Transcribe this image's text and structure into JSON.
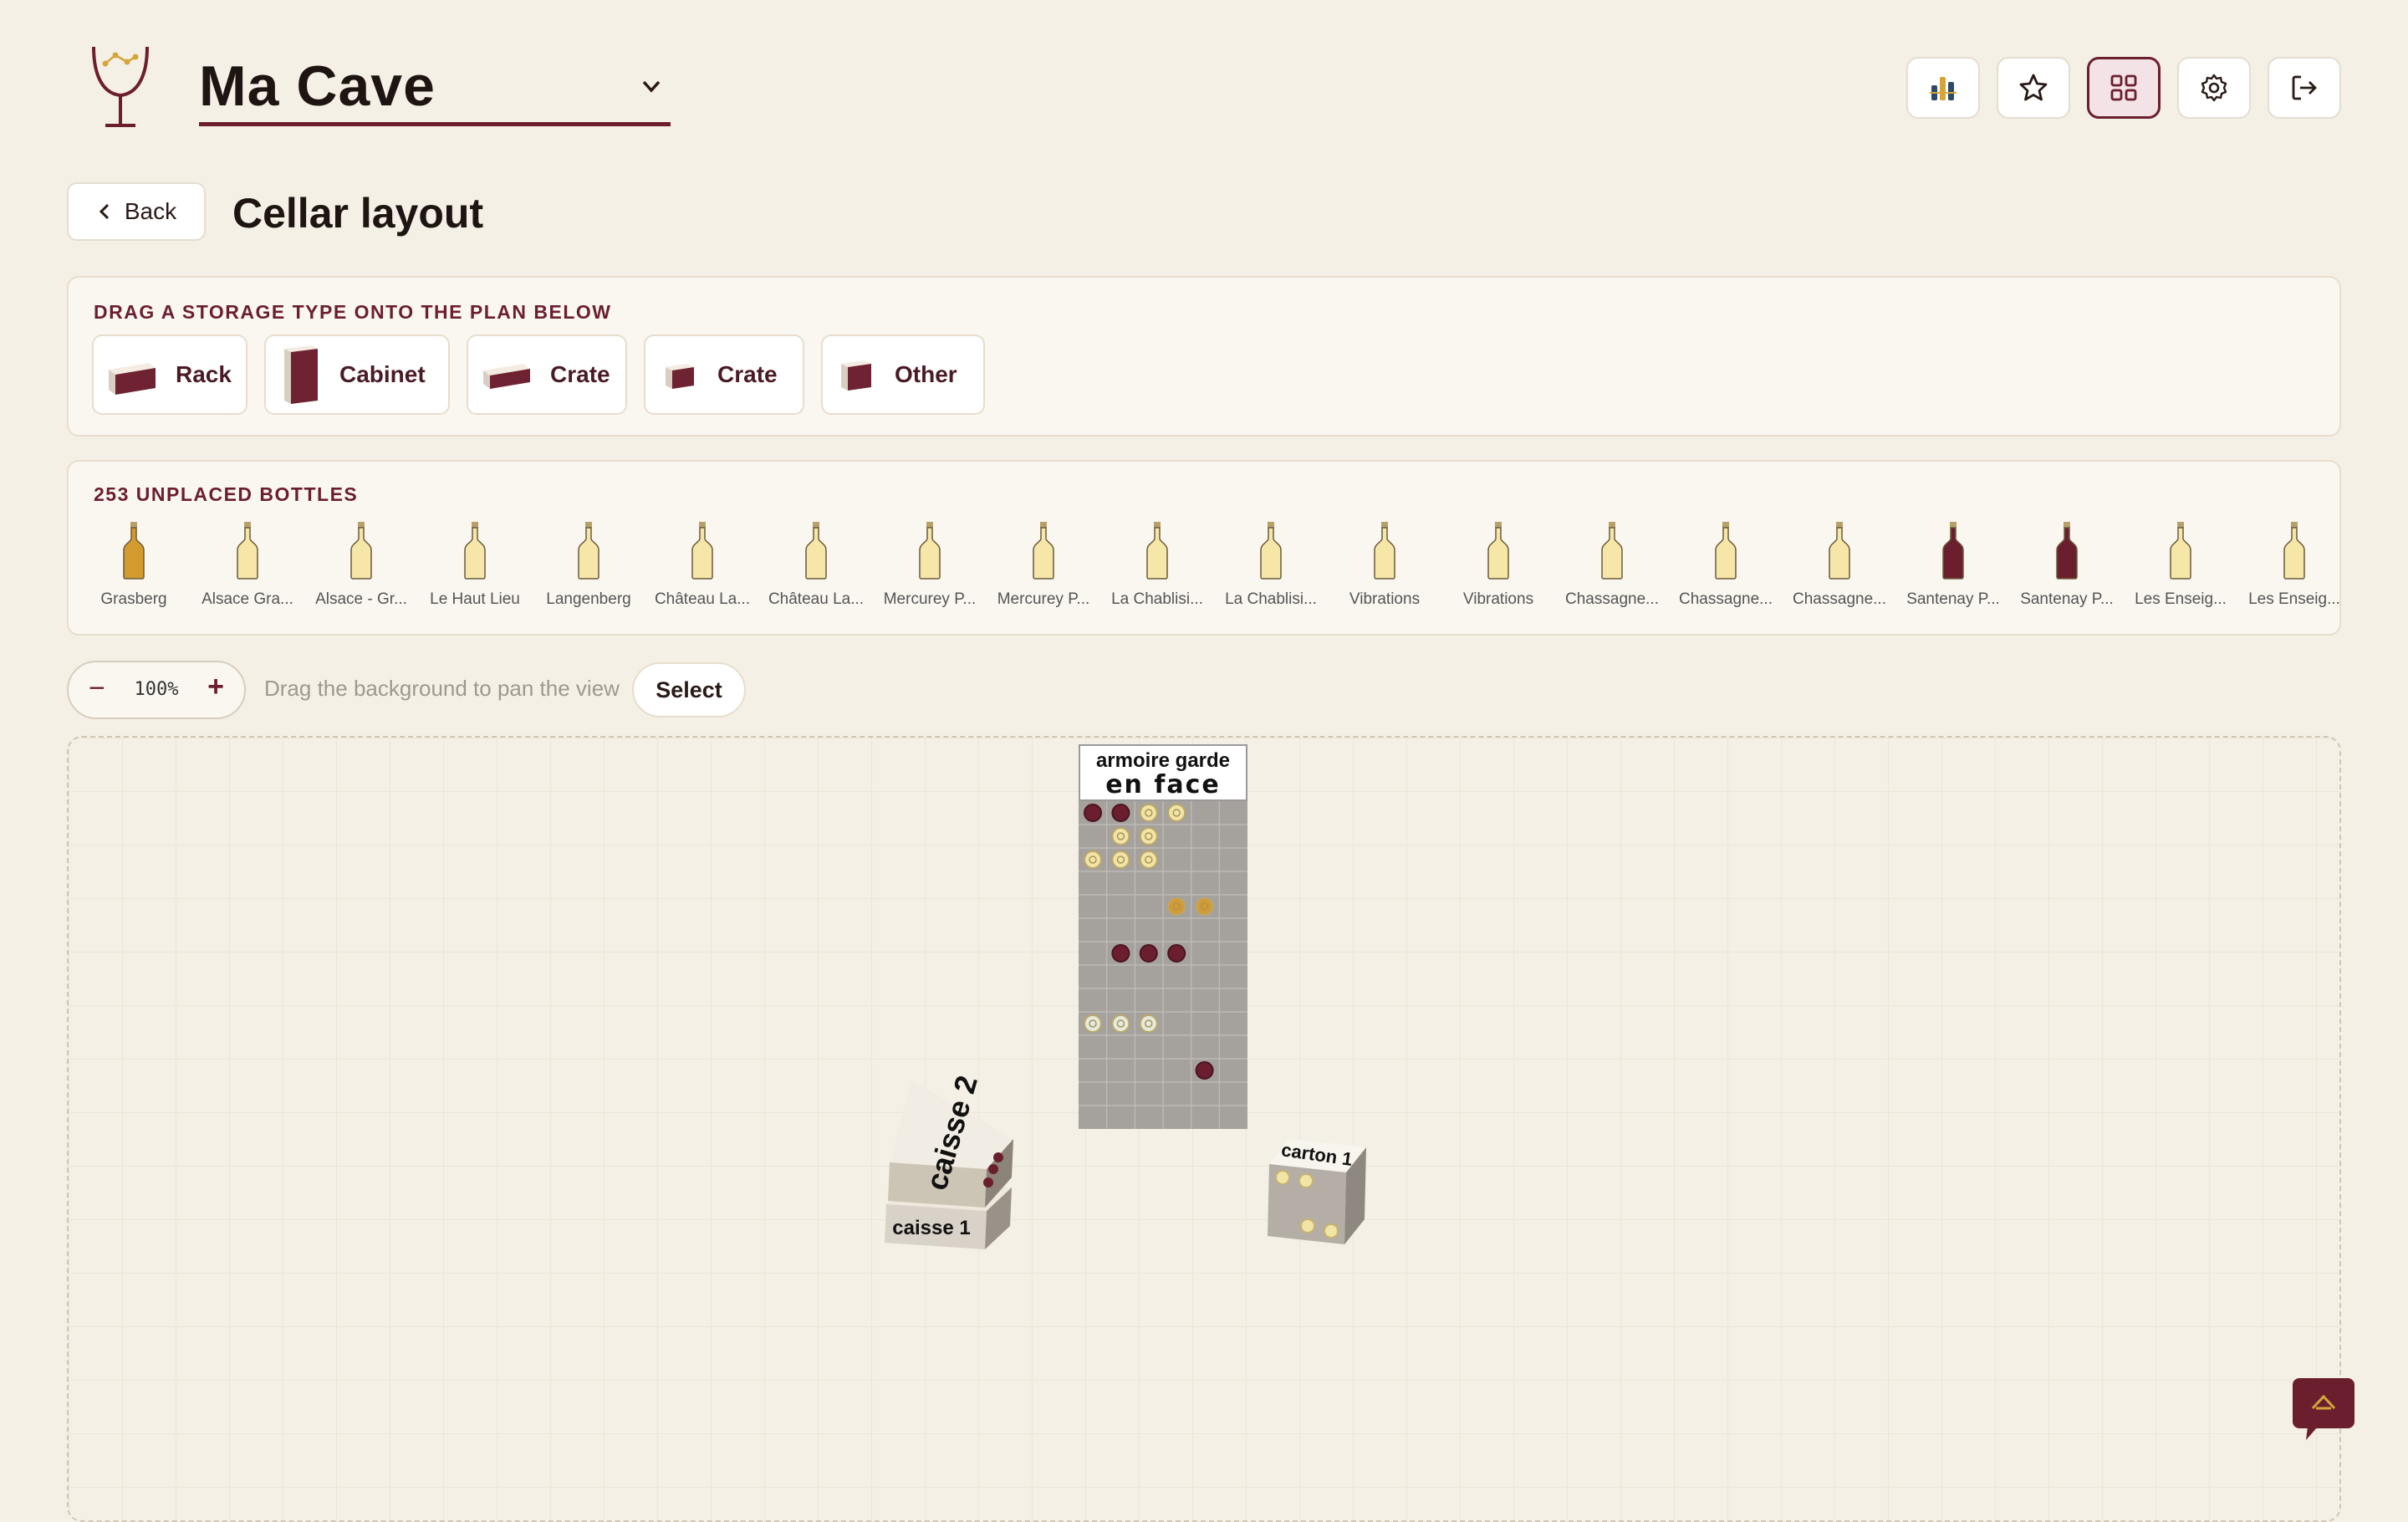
{
  "header": {
    "cellar_name": "Ma Cave",
    "icons": [
      "wine-glass-logo-icon",
      "chevron-down-icon",
      "stats-icon",
      "star-icon",
      "grid-icon",
      "gear-icon",
      "logout-icon"
    ]
  },
  "nav": {
    "back_label": "Back",
    "page_title": "Cellar layout"
  },
  "storage_panel": {
    "title": "DRAG A STORAGE TYPE ONTO THE PLAN BELOW",
    "types": [
      {
        "label": "Rack",
        "icon": "rack-icon"
      },
      {
        "label": "Cabinet",
        "icon": "cabinet-icon"
      },
      {
        "label": "Crate",
        "icon": "crate-icon"
      },
      {
        "label": "Crate",
        "icon": "small-crate-icon"
      },
      {
        "label": "Other",
        "icon": "other-storage-icon"
      }
    ]
  },
  "bottles_panel": {
    "title": "253 UNPLACED BOTTLES",
    "bottles": [
      {
        "label": "Grasberg",
        "color": "#d39a2e"
      },
      {
        "label": "Alsace Gra...",
        "color": "#f6e6a8"
      },
      {
        "label": "Alsace - Gr...",
        "color": "#f6e6a8"
      },
      {
        "label": "Le Haut Lieu",
        "color": "#f6e6a8"
      },
      {
        "label": "Langenberg",
        "color": "#f6e6a8"
      },
      {
        "label": "Château La...",
        "color": "#f6e6a8"
      },
      {
        "label": "Château La...",
        "color": "#f6e6a8"
      },
      {
        "label": "Mercurey P...",
        "color": "#f6e6a8"
      },
      {
        "label": "Mercurey P...",
        "color": "#f6e6a8"
      },
      {
        "label": "La Chablisi...",
        "color": "#f6e6a8"
      },
      {
        "label": "La Chablisi...",
        "color": "#f6e6a8"
      },
      {
        "label": "Vibrations",
        "color": "#f6e6a8"
      },
      {
        "label": "Vibrations",
        "color": "#f6e6a8"
      },
      {
        "label": "Chassagne...",
        "color": "#f6e6a8"
      },
      {
        "label": "Chassagne...",
        "color": "#f6e6a8"
      },
      {
        "label": "Chassagne...",
        "color": "#f6e6a8"
      },
      {
        "label": "Santenay P...",
        "color": "#6b1e2e"
      },
      {
        "label": "Santenay P...",
        "color": "#6b1e2e"
      },
      {
        "label": "Les Enseig...",
        "color": "#f6e6a8"
      },
      {
        "label": "Les Enseig...",
        "color": "#f6e6a8"
      }
    ]
  },
  "toolbar": {
    "zoom_minus": "−",
    "zoom_value": "100%",
    "zoom_plus": "+",
    "hint": "Drag the background to pan the view",
    "select_label": "Select"
  },
  "plan": {
    "armoire": {
      "title_line1": "armoire garde",
      "title_line2": "en face",
      "columns": 6,
      "rows": 12,
      "slots": [
        {
          "row": 0,
          "col": 0,
          "color": "#6b1e2e"
        },
        {
          "row": 0,
          "col": 1,
          "color": "#6b1e2e"
        },
        {
          "row": 0,
          "col": 2,
          "color": "#f1e4a6"
        },
        {
          "row": 0,
          "col": 3,
          "color": "#f1e4a6"
        },
        {
          "row": 1,
          "col": 1,
          "color": "#f1e4a6"
        },
        {
          "row": 1,
          "col": 2,
          "color": "#f1e4a6"
        },
        {
          "row": 2,
          "col": 0,
          "color": "#f1e4a6"
        },
        {
          "row": 2,
          "col": 1,
          "color": "#f1e4a6"
        },
        {
          "row": 2,
          "col": 2,
          "color": "#f1e4a6"
        },
        {
          "row": 4,
          "col": 3,
          "color": "#d49b35"
        },
        {
          "row": 4,
          "col": 4,
          "color": "#d49b35"
        },
        {
          "row": 6,
          "col": 1,
          "color": "#6b1e2e"
        },
        {
          "row": 6,
          "col": 2,
          "color": "#6b1e2e"
        },
        {
          "row": 6,
          "col": 3,
          "color": "#6b1e2e"
        },
        {
          "row": 9,
          "col": 0,
          "color": "#e4eadc"
        },
        {
          "row": 9,
          "col": 1,
          "color": "#e4eadc"
        },
        {
          "row": 9,
          "col": 2,
          "color": "#e4eadc"
        },
        {
          "row": 11,
          "col": 4,
          "color": "#6b1e2e"
        }
      ]
    },
    "caisse2": {
      "label": "caisse 2"
    },
    "caisse1": {
      "label": "caisse 1"
    },
    "carton1": {
      "label": "carton 1"
    }
  },
  "chat_icon": "chat-icon"
}
